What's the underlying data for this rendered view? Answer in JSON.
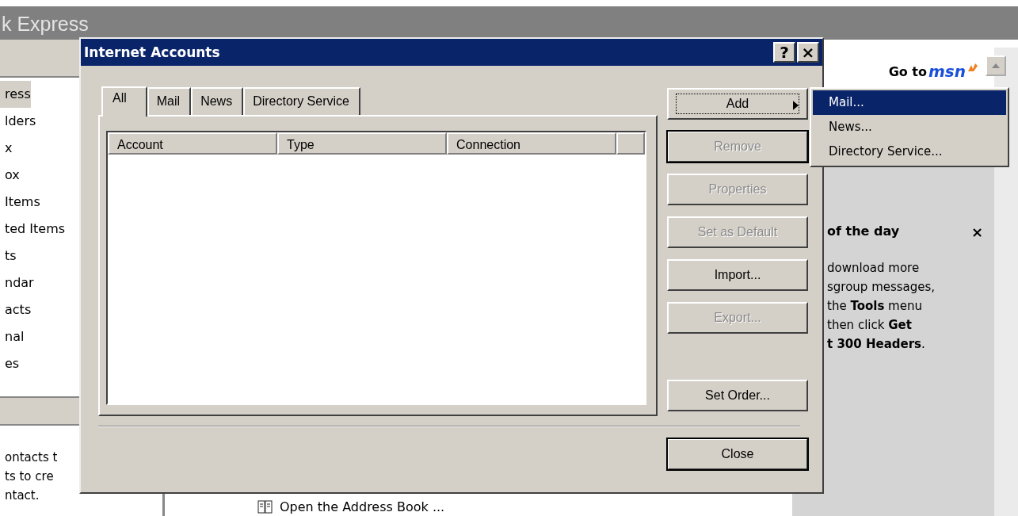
{
  "app_window": {
    "title": "k Express",
    "folders": [
      {
        "label": "ress",
        "selected": true
      },
      {
        "label": "lders",
        "selected": false
      },
      {
        "label": "x",
        "selected": false
      },
      {
        "label": "ox",
        "selected": false
      },
      {
        "label": "Items",
        "selected": false
      },
      {
        "label": "ted Items",
        "selected": false
      },
      {
        "label": "ts",
        "selected": false
      },
      {
        "label": "ndar",
        "selected": false
      },
      {
        "label": "acts",
        "selected": false
      },
      {
        "label": "nal",
        "selected": false
      },
      {
        "label": "es",
        "selected": false
      }
    ],
    "contacts_text": [
      "ontacts t",
      "ts to cre",
      "ntact."
    ],
    "address_book_link": "Open the Address Book ...",
    "msn_link": {
      "prefix": "Go to",
      "brand": "msn"
    },
    "tip": {
      "title": "of the day",
      "close": "×",
      "lines": [
        "download more",
        "sgroup messages,",
        "the **Tools** menu",
        "then click **Get**",
        "**t 300 Headers**."
      ]
    }
  },
  "dialog": {
    "title": "Internet Accounts",
    "help": "?",
    "close": "×",
    "tabs": [
      {
        "label": "All",
        "selected": true
      },
      {
        "label": "Mail",
        "selected": false
      },
      {
        "label": "News",
        "selected": false
      },
      {
        "label": "Directory Service",
        "selected": false
      }
    ],
    "table": {
      "columns": [
        "Account",
        "Type",
        "Connection"
      ]
    },
    "buttons": [
      {
        "label": "Add",
        "disabled": false,
        "focused": true,
        "default": false,
        "submenu": true
      },
      {
        "label": "Remove",
        "disabled": true,
        "focused": false,
        "default": true,
        "submenu": false
      },
      {
        "label": "Properties",
        "disabled": true,
        "focused": false,
        "default": false,
        "submenu": false
      },
      {
        "label": "Set as Default",
        "disabled": true,
        "focused": false,
        "default": false,
        "submenu": false
      },
      {
        "label": "Import...",
        "disabled": false,
        "focused": false,
        "default": false,
        "submenu": false
      },
      {
        "label": "Export...",
        "disabled": true,
        "focused": false,
        "default": false,
        "submenu": false
      },
      {
        "label": "Set Order...",
        "disabled": false,
        "focused": false,
        "default": false,
        "submenu": false
      }
    ],
    "close_button": "Close"
  },
  "add_menu": [
    {
      "label": "Mail...",
      "selected": true
    },
    {
      "label": "News...",
      "selected": false
    },
    {
      "label": "Directory Service...",
      "selected": false
    }
  ]
}
